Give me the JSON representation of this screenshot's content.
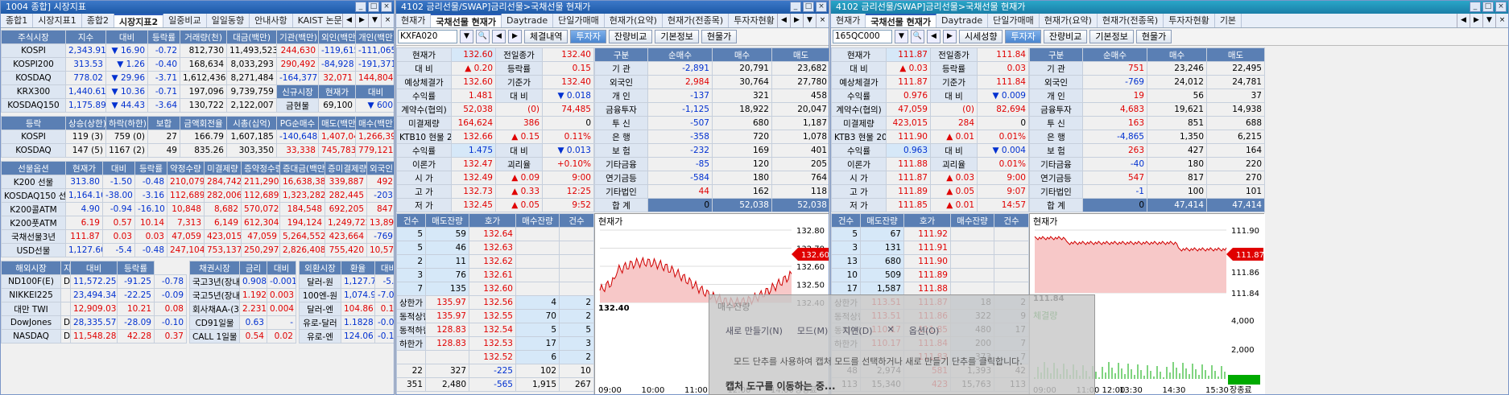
{
  "w1": {
    "title": "1004 종합] 시장지표",
    "tabs": [
      "종합1",
      "시장지표1",
      "종합2",
      "시장지표2",
      "일중비교",
      "일일동향",
      "안내사항",
      "KAIST 논문검색",
      "CHE"
    ],
    "market": {
      "headers": [
        "주식시장",
        "지수",
        "대비",
        "등락률",
        "거래량(천)",
        "대금(백만)",
        "기관(백만)",
        "외인(백만)",
        "개인(백만)"
      ],
      "rows": [
        [
          "KOSPI",
          "2,343.91",
          "▼",
          "16.90",
          "-0.72",
          "812,730",
          "11,493,523",
          "244,630",
          "-119,615",
          "-111,065"
        ],
        [
          "KOSPI200",
          "313.53",
          "▼",
          "1.26",
          "-0.40",
          "168,634",
          "8,033,293",
          "290,492",
          "-84,928",
          "-191,371"
        ],
        [
          "KOSDAQ",
          "778.02",
          "▼",
          "29.96",
          "-3.71",
          "1,612,436",
          "8,271,484",
          "-164,377",
          "32,071",
          "144,804"
        ],
        [
          "KRX300",
          "1,440.61",
          "▼",
          "10.36",
          "-0.71",
          "197,096",
          "9,739,759"
        ],
        [
          "KOSDAQ150",
          "1,175.89",
          "▼",
          "44.43",
          "-3.64",
          "130,722",
          "2,122,007"
        ]
      ],
      "sub": {
        "h1": "신규시장",
        "h2": "현재가",
        "h3": "대비",
        "r1": "금현물",
        "v1": "69,100",
        "v2": "▼",
        "v3": "600"
      }
    },
    "updown": {
      "headers": [
        "등락",
        "상승(상한)",
        "하락(하한)",
        "보합",
        "금액회전율",
        "시총(십억)",
        "PG순매수",
        "매도(백만)",
        "매수(백만)"
      ],
      "rows": [
        [
          "KOSPI",
          "119 (3)",
          "759 (0)",
          "27",
          "166.79",
          "1,607,185",
          "-140,648",
          "1,407,044",
          "1,266,396"
        ],
        [
          "KOSDAQ",
          "147 (5)",
          "1167 (2)",
          "49",
          "835.26",
          "303,350",
          "33,338",
          "745,783",
          "779,121"
        ]
      ]
    },
    "futures": {
      "headers": [
        "선물옵션",
        "현재가",
        "대비",
        "등락률",
        "약정수량",
        "미결제량",
        "증약정수량",
        "증대금(백만)",
        "증미결제량",
        "외국인"
      ],
      "rows": [
        [
          "K200 선물",
          "313.80",
          "-1.50",
          "-0.48",
          "210,079",
          "284,742",
          "211,290",
          "16,638,382",
          "339,887",
          "492"
        ],
        [
          "KOSDAQ150 선물",
          "1,164.10",
          "-38.00",
          "-3.16",
          "112,689",
          "282,006",
          "112,689",
          "1,323,282",
          "282,445",
          "-203"
        ],
        [
          "K200콜ATM",
          "4.90",
          "-0.94",
          "-16.10",
          "10,848",
          "8,682",
          "570,072",
          "184,548",
          "692,205",
          "847"
        ],
        [
          "K200풋ATM",
          "6.19",
          "0.57",
          "10.14",
          "7,313",
          "6,149",
          "612,304",
          "194,124",
          "1,249,722",
          "13,897"
        ],
        [
          "국채선물3년",
          "111.87",
          "0.03",
          "0.03",
          "47,059",
          "423,015",
          "47,059",
          "5,264,552",
          "423,664",
          "-769"
        ],
        [
          "USD선물",
          "1,127.60",
          "-5.4",
          "-0.48",
          "247,104",
          "753,137",
          "250,297",
          "2,826,408",
          "755,420",
          "10,574"
        ]
      ]
    },
    "overseas": {
      "headers": [
        "해외시장",
        "지수",
        "대비",
        "등락률"
      ],
      "rows": [
        [
          "ND100F(E)",
          "D",
          "11,572.25",
          "-91.25",
          "-0.78"
        ],
        [
          "NIKKEI225",
          "",
          "23,494.34",
          "-22.25",
          "-0.09"
        ],
        [
          "대만 TWI",
          "",
          "12,909.03",
          "10.21",
          "0.08"
        ],
        [
          "DowJones",
          "D",
          "28,335.57",
          "-28.09",
          "-0.10"
        ],
        [
          "NASDAQ",
          "D",
          "11,548.28",
          "42.28",
          "0.37"
        ]
      ]
    },
    "bond": {
      "headers": [
        "채권시장",
        "금리",
        "대비"
      ],
      "rows": [
        [
          "국고3년(장내)",
          "0.908",
          "-0.001"
        ],
        [
          "국고5년(장내)",
          "1.192",
          "0.003"
        ],
        [
          "회사채AA-(3)",
          "2.231",
          "0.004"
        ],
        [
          "CD91일물",
          "0.63",
          "-"
        ],
        [
          "CALL 1일물",
          "0.54",
          "0.02"
        ]
      ]
    },
    "fx": {
      "headers": [
        "외환시장",
        "환율",
        "대비"
      ],
      "rows": [
        [
          "달러-원",
          "1,127.7",
          "-5.2"
        ],
        [
          "100엔-원",
          "1,074.93",
          "-7.00"
        ],
        [
          "달러-엔",
          "104.86",
          "0.15"
        ],
        [
          "유로-달러",
          "1.1828",
          "-0.0031"
        ],
        [
          "유로-엔",
          "124.06",
          "-0.12"
        ]
      ]
    }
  },
  "w2": {
    "title": "4102 금리선물/SWAP]금리선물>국채선물 현재가",
    "tabs": [
      "현재가",
      "국채선물 현재가",
      "Daytrade",
      "단일가매매",
      "현재가(요약)",
      "현재가(전종목)",
      "투자자현황",
      "기본"
    ],
    "code": "KXFA020",
    "btns": [
      "체결내역",
      "투자자",
      "잔량비교",
      "기본정보",
      "현물가"
    ],
    "left": [
      [
        "현재가",
        "132.60",
        "전일종가",
        "132.40"
      ],
      [
        "대 비",
        "▲ 0.20",
        "등락률",
        "0.15"
      ],
      [
        "예상체결가",
        "132.60",
        "기준가",
        "132.40"
      ],
      [
        "수익률",
        "1.481",
        "대 비",
        "▼ 0.018"
      ],
      [
        "계약수(협의)",
        "52,038",
        "(0)",
        "74,485"
      ],
      [
        "미결제량",
        "164,624",
        "386",
        "0"
      ],
      [
        "KTB10 현물 20",
        "132.66",
        "▲ 0.15",
        "0.11%"
      ],
      [
        "수익률",
        "1.475",
        "대 비",
        "▼ 0.013"
      ],
      [
        "이론가",
        "132.47",
        "괴리율",
        "+0.10%"
      ],
      [
        "시 가",
        "132.49",
        "▲ 0.09",
        "9:00"
      ],
      [
        "고 가",
        "132.73",
        "▲ 0.33",
        "12:25"
      ],
      [
        "저 가",
        "132.45",
        "▲ 0.05",
        "9:52"
      ]
    ],
    "inv": {
      "headers": [
        "구분",
        "순매수",
        "매수",
        "매도"
      ],
      "rows": [
        [
          "기 관",
          "-2,891",
          "20,791",
          "23,682"
        ],
        [
          "외국인",
          "2,984",
          "30,764",
          "27,780"
        ],
        [
          "개 인",
          "-137",
          "321",
          "458"
        ],
        [
          "금융투자",
          "-1,125",
          "18,922",
          "20,047"
        ],
        [
          "투 신",
          "-507",
          "680",
          "1,187"
        ],
        [
          "은 행",
          "-358",
          "720",
          "1,078"
        ],
        [
          "보 험",
          "-232",
          "169",
          "401"
        ],
        [
          "기타금융",
          "-85",
          "120",
          "205"
        ],
        [
          "연기금등",
          "-584",
          "180",
          "764"
        ],
        [
          "기타법인",
          "44",
          "162",
          "118"
        ],
        [
          "합 계",
          "0",
          "52,038",
          "52,038"
        ]
      ]
    },
    "ob": {
      "headers": [
        "건수",
        "매도잔량",
        "호가",
        "매수잔량",
        "건수"
      ],
      "ask": [
        [
          "5",
          "59",
          "132.64"
        ],
        [
          "5",
          "46",
          "132.63"
        ],
        [
          "2",
          "11",
          "132.62"
        ],
        [
          "3",
          "76",
          "132.61"
        ],
        [
          "7",
          "135",
          "132.60"
        ]
      ],
      "bid": [
        [
          "132.56",
          "4",
          "2"
        ],
        [
          "132.55",
          "70",
          "2"
        ],
        [
          "132.54",
          "5",
          "5"
        ],
        [
          "132.53",
          "17",
          "3"
        ],
        [
          "132.52",
          "6",
          "2"
        ]
      ],
      "lim": [
        [
          "상한가",
          "135.97"
        ],
        [
          "동적상한",
          "135.97"
        ],
        [
          "동적하한",
          "128.83"
        ],
        [
          "하한가",
          "128.83"
        ]
      ],
      "tot": [
        "22",
        "327",
        "-225",
        "102",
        "10"
      ],
      "tot2": [
        "351",
        "2,480",
        "-565",
        "1,915",
        "267"
      ],
      "foot": "잔량비교"
    },
    "chart": {
      "label": "현재가",
      "yticks": [
        "132.80",
        "132.70",
        "132.60",
        "132.50",
        "132.40"
      ],
      "lo": "132.40",
      "cur": "132.60",
      "xt": [
        "09:00",
        "10:00",
        "11:00",
        "12:00",
        "14:00"
      ],
      "end": "장종료",
      "ov": "모드 단추를 사용하여 캡처 모드를 선택하거나 새로 만들기 단추를 클릭합니다.",
      "ov2": "캡처 도구를 이동하는 중...",
      "ov3": "새로 만들기(N)",
      "ov4": "모드(M)",
      "ov5": "지연(D)",
      "ov6": "옵션(O)",
      "ov7": "매수잔량"
    }
  },
  "w3": {
    "title": "4102 금리선물/SWAP]금리선물>국채선물 현재가",
    "tabs": [
      "현재가",
      "국채선물 현재가",
      "Daytrade",
      "단일가매매",
      "현재가(요약)",
      "현재가(전종목)",
      "투자자현황",
      "기본"
    ],
    "code": "165QC000",
    "btns": [
      "시세성향",
      "투자자",
      "잔량비교",
      "기본정보",
      "현물가"
    ],
    "left": [
      [
        "현재가",
        "111.87",
        "전일종가",
        "111.84"
      ],
      [
        "대 비",
        "▲ 0.03",
        "등락률",
        "0.03"
      ],
      [
        "예상체결가",
        "111.87",
        "기준가",
        "111.84"
      ],
      [
        "수익률",
        "0.976",
        "대 비",
        "▼ 0.009"
      ],
      [
        "계약수(협의)",
        "47,059",
        "(0)",
        "82,694"
      ],
      [
        "미결제량",
        "423,015",
        "284",
        "0"
      ],
      [
        "KTB3 현물 201",
        "111.90",
        "▲ 0.01",
        "0.01%"
      ],
      [
        "수익률",
        "0.963",
        "대 비",
        "▼ 0.004"
      ],
      [
        "이론가",
        "111.88",
        "괴리율",
        "0.01%"
      ],
      [
        "시 가",
        "111.87",
        "▲ 0.03",
        "9:00"
      ],
      [
        "고 가",
        "111.89",
        "▲ 0.05",
        "9:07"
      ],
      [
        "저 가",
        "111.85",
        "▲ 0.01",
        "14:57"
      ]
    ],
    "inv": {
      "headers": [
        "구분",
        "순매수",
        "매수",
        "매도"
      ],
      "rows": [
        [
          "기 관",
          "751",
          "23,246",
          "22,495"
        ],
        [
          "외국인",
          "-769",
          "24,012",
          "24,781"
        ],
        [
          "개 인",
          "19",
          "56",
          "37"
        ],
        [
          "금융투자",
          "4,683",
          "19,621",
          "14,938"
        ],
        [
          "투 신",
          "163",
          "851",
          "688"
        ],
        [
          "은 행",
          "-4,865",
          "1,350",
          "6,215"
        ],
        [
          "보 험",
          "263",
          "427",
          "164"
        ],
        [
          "기타금융",
          "-40",
          "180",
          "220"
        ],
        [
          "연기금등",
          "547",
          "817",
          "270"
        ],
        [
          "기타법인",
          "-1",
          "100",
          "101"
        ],
        [
          "합 계",
          "0",
          "47,414",
          "47,414"
        ]
      ]
    },
    "ob": {
      "headers": [
        "건수",
        "매도잔량",
        "호가",
        "매수잔량",
        "건수"
      ],
      "ask": [
        [
          "5",
          "67",
          "111.92"
        ],
        [
          "3",
          "131",
          "111.91"
        ],
        [
          "13",
          "680",
          "111.90"
        ],
        [
          "10",
          "509",
          "111.89"
        ],
        [
          "17",
          "1,587",
          "111.88"
        ]
      ],
      "bid": [
        [
          "111.87",
          "18",
          "2"
        ],
        [
          "111.86",
          "322",
          "9"
        ],
        [
          "111.85",
          "480",
          "17"
        ],
        [
          "111.84",
          "200",
          "7"
        ],
        [
          "111.83",
          "373",
          "7"
        ]
      ],
      "lim": [
        [
          "상한가",
          "113.51"
        ],
        [
          "동적상한",
          "113.51"
        ],
        [
          "동적하한",
          "110.17"
        ],
        [
          "하한가",
          "110.17"
        ]
      ],
      "tot": [
        "48",
        "2,974",
        "581",
        "1,393",
        "42"
      ],
      "tot2": [
        "113",
        "15,340",
        "423",
        "15,763",
        "113"
      ],
      "foot": "잔량비교"
    },
    "chart": {
      "label": "현재가",
      "yticks": [
        "111.90",
        "111.88",
        "111.86",
        "111.84"
      ],
      "lo": "111.84",
      "cur": "111.87",
      "xt": [
        "09:00",
        "11:00 12:00",
        "13:30",
        "14:30",
        "15:30"
      ],
      "end": "장종료",
      "vol": "체결량",
      "vt": [
        "4,000",
        "2,000",
        "0"
      ]
    }
  }
}
